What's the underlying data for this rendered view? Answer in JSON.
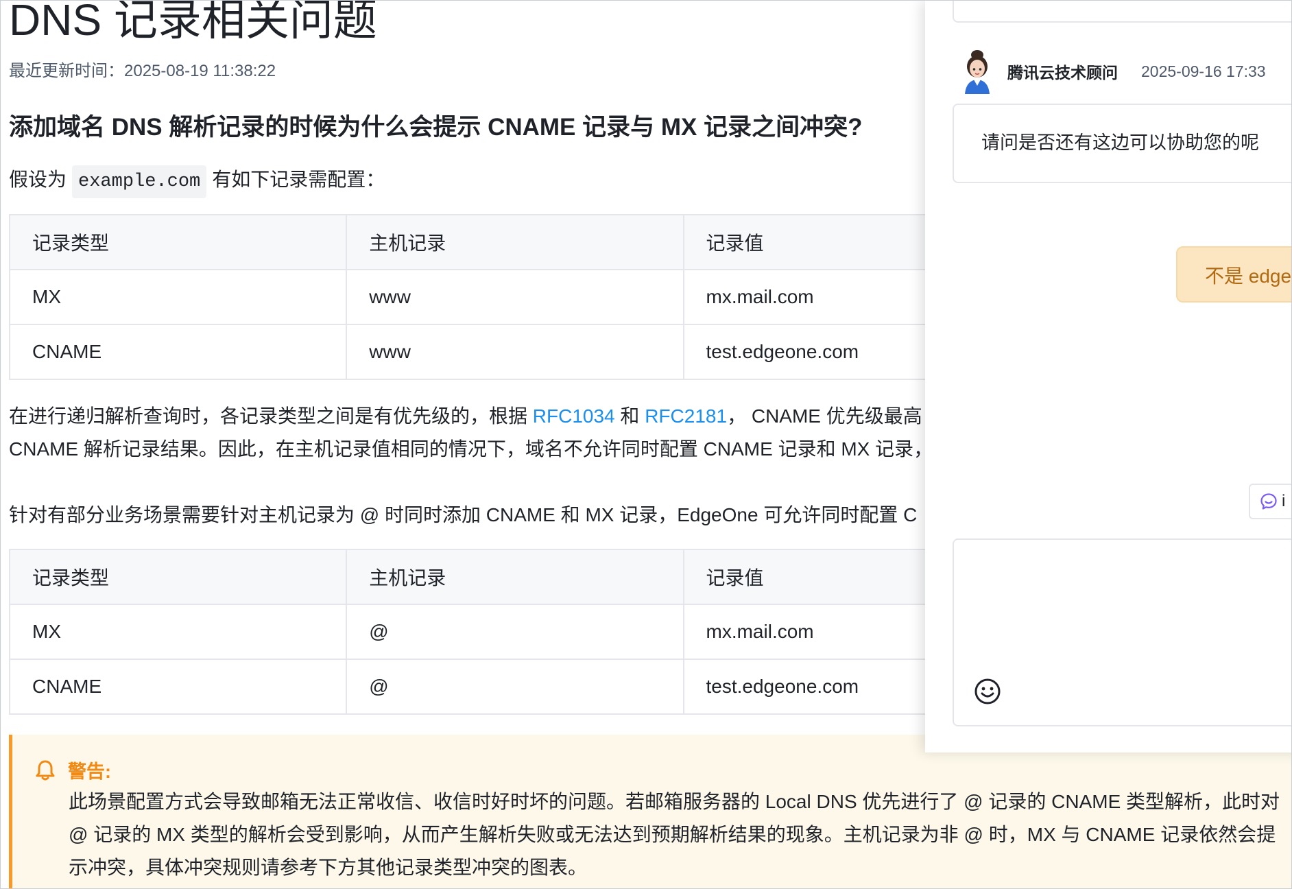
{
  "article": {
    "title": "DNS 记录相关问题",
    "updated": "最近更新时间：2025-08-19 11:38:22",
    "question": "添加域名 DNS 解析记录的时候为什么会提示 CNAME 记录与 MX 记录之间冲突?",
    "suppose_prefix": "假设为",
    "suppose_code": "example.com",
    "suppose_suffix": "有如下记录需配置：",
    "table_headers": [
      "记录类型",
      "主机记录",
      "记录值"
    ],
    "table1_rows": [
      [
        "MX",
        "www",
        "mx.mail.com"
      ],
      [
        "CNAME",
        "www",
        "test.edgeone.com"
      ]
    ],
    "recursion_line1_a": "在进行递归解析查询时，各记录类型之间是有优先级的，根据",
    "recursion_link1": "RFC1034",
    "recursion_and": "和",
    "recursion_link2": "RFC2181",
    "recursion_line1_b": "， CNAME 优先级最高",
    "recursion_line2": "CNAME 解析记录结果。因此，在主机记录值相同的情况下，域名不允许同时配置 CNAME 记录和 MX 记录，",
    "note": "针对有部分业务场景需要针对主机记录为 @ 时同时添加 CNAME 和 MX 记录，EdgeOne 可允许同时配置 C",
    "table2_rows": [
      [
        "MX",
        "@",
        "mx.mail.com"
      ],
      [
        "CNAME",
        "@",
        "test.edgeone.com"
      ]
    ],
    "warning_title": "警告:",
    "warning_lines": [
      "此场景配置方式会导致邮箱无法正常收信、收信时好时坏的问题。若邮箱服务器的 Local DNS 优先进行了 @ 记录的 CNAME 类型解析，此时对",
      "@ 记录的 MX 类型的解析会受到影响，从而产生解析失败或无法达到预期解析结果的现象。主机记录为非 @ 时，MX 与 CNAME 记录依然会提",
      "示冲突，具体冲突规则请参考下方其他记录类型冲突的图表。"
    ]
  },
  "chat": {
    "agent_name": "腾讯云技术顾问",
    "agent_time": "2025-09-16 17:33",
    "agent_message": "请问是否还有这边可以协助您的呢",
    "user_message": "不是 edge",
    "quick_button_label": "i"
  },
  "colors": {
    "link": "#1a8ff0",
    "warning_accent": "#f79a2a",
    "warning_bg": "#fdf8ea",
    "user_bubble": "#fbe6c1",
    "quick_icon": "#7b5cf5"
  },
  "icons": {
    "warning": "bell-icon",
    "avatar": "agent-avatar",
    "quick": "chat-bubble-icon",
    "emoji": "smile-icon"
  }
}
